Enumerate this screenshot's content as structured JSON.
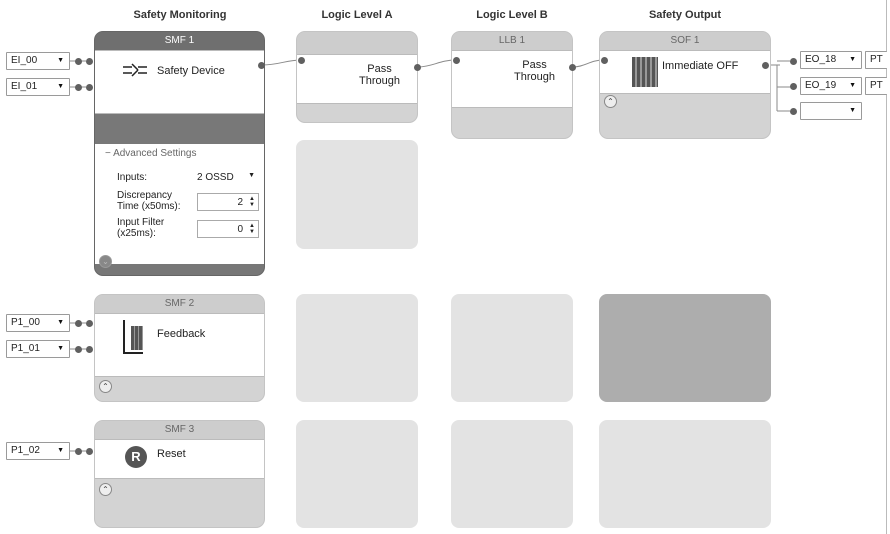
{
  "columns": [
    "Safety Monitoring",
    "Logic Level A",
    "Logic Level B",
    "Safety Output"
  ],
  "smf1": {
    "title": "SMF 1",
    "label": "Safety Device",
    "inputs": [
      "EI_00",
      "EI_01"
    ],
    "advanced": {
      "heading": "Advanced Settings",
      "inputs_label": "Inputs:",
      "inputs_value": "2 OSSD",
      "discrepancy_label_1": "Discrepancy",
      "discrepancy_label_2": "Time (x50ms):",
      "discrepancy_value": "2",
      "filter_label_1": "Input Filter",
      "filter_label_2": "(x25ms):",
      "filter_value": "0"
    }
  },
  "la1": {
    "title": "",
    "line1": "Pass",
    "line2": "Through"
  },
  "llb1": {
    "title": "LLB 1",
    "line1": "Pass",
    "line2": "Through"
  },
  "sof1": {
    "title": "SOF 1",
    "label": "Immediate OFF"
  },
  "outputs": [
    {
      "value": "EO_18",
      "extra": "PT"
    },
    {
      "value": "EO_19",
      "extra": "PT"
    },
    {
      "value": "",
      "extra": ""
    }
  ],
  "smf2": {
    "title": "SMF 2",
    "label": "Feedback",
    "inputs": [
      "P1_00",
      "P1_01"
    ]
  },
  "smf3": {
    "title": "SMF 3",
    "label": "Reset",
    "icon_letter": "R",
    "inputs": [
      "P1_02"
    ]
  }
}
